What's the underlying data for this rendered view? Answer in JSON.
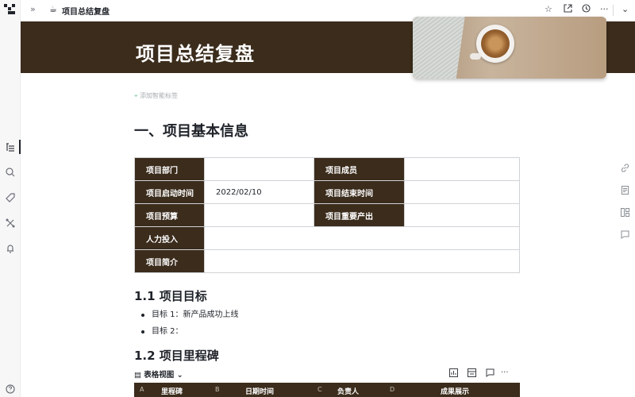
{
  "app": {
    "doc_emoji": "☕",
    "doc_title": "项目总结复盘"
  },
  "topbar": {
    "icons": [
      "expand-sidebar-icon",
      "star-icon",
      "open-new-window-icon",
      "history-icon",
      "more-icon",
      "chevron-down-icon"
    ]
  },
  "banner": {
    "title": "项目总结复盘",
    "background_color": "#3b2c1c"
  },
  "tags": {
    "add_label": "添加智能标签"
  },
  "section1": {
    "heading": "一、项目基本信息",
    "table": {
      "rows": [
        [
          {
            "label": "项目部门",
            "value": ""
          },
          {
            "label": "项目成员",
            "value": ""
          }
        ],
        [
          {
            "label": "项目启动时间",
            "value": "2022/02/10"
          },
          {
            "label": "项目结束时间",
            "value": ""
          }
        ],
        [
          {
            "label": "项目预算",
            "value": ""
          },
          {
            "label": "项目重要产出",
            "value": ""
          }
        ],
        [
          {
            "label": "人力投入",
            "value": ""
          }
        ],
        [
          {
            "label": "项目简介",
            "value": ""
          }
        ]
      ]
    }
  },
  "goals": {
    "heading": "1.1 项目目标",
    "items": [
      "目标 1：新产品成功上线",
      "目标 2："
    ]
  },
  "milestones": {
    "heading": "1.2 项目里程碑",
    "view_name": "表格视图",
    "columns": [
      {
        "letter": "A",
        "name": "里程碑"
      },
      {
        "letter": "B",
        "name": "日期时间"
      },
      {
        "letter": "C",
        "name": "负责人"
      },
      {
        "letter": "D",
        "name": "成果展示"
      }
    ]
  },
  "sidebar": {
    "icons": [
      "outline-icon",
      "search-icon",
      "tag-icon",
      "connections-icon",
      "notifications-icon",
      "help-icon"
    ]
  },
  "right_toolbar": {
    "icons": [
      "link-icon",
      "document-icon",
      "layout-icon",
      "comment-icon"
    ]
  }
}
